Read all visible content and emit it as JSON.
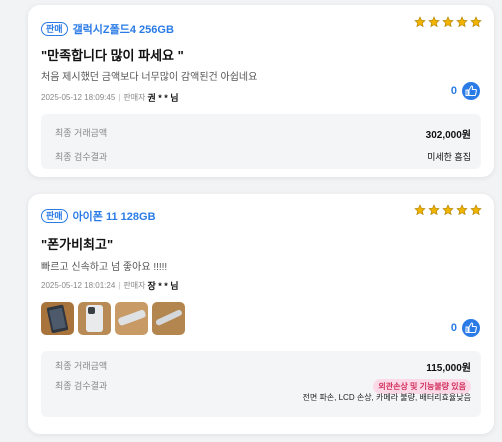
{
  "reviews": [
    {
      "badge": "판매",
      "product": "갤럭시Z폴드4 256GB",
      "rating": 5,
      "title": "\"만족합니다 많이 파세요 \"",
      "body": "처음 제시했던 금액보다 너무많이 감액된건 아쉽네요",
      "date": "2025-05-12 18:09:45",
      "seller_label": "판매자",
      "seller": "권 * * 님",
      "likes": "0",
      "price_label": "최종 거래금액",
      "price": "302,000원",
      "inspect_label": "최종 검수결과",
      "inspect_result": "미세한 흠집"
    },
    {
      "badge": "판매",
      "product": "아이폰 11 128GB",
      "rating": 5,
      "title": "\"폰가비최고\"",
      "body": "빠르고 신속하고 넘 좋아요 !!!!!",
      "date": "2025-05-12 18:01:24",
      "seller_label": "판매자",
      "seller": "장 * * 님",
      "likes": "0",
      "price_label": "최종 거래금액",
      "price": "115,000원",
      "inspect_label": "최종 검수결과",
      "inspect_badge": "외관손상 및 기능불량 있음",
      "inspect_detail": "전면 파손, LCD 손상, 카메라 불량, 배터리효율낮음",
      "photos": [
        "phone-front-photo",
        "phone-back-photo",
        "phone-side-photo",
        "phone-edge-photo"
      ]
    }
  ],
  "colors": {
    "accent": "#2a7be6",
    "star": "#f0b400",
    "warn_bg": "#fcd9e6",
    "warn_text": "#d1315f"
  },
  "icons": {
    "star": "star-icon",
    "like": "thumbs-up-icon"
  }
}
